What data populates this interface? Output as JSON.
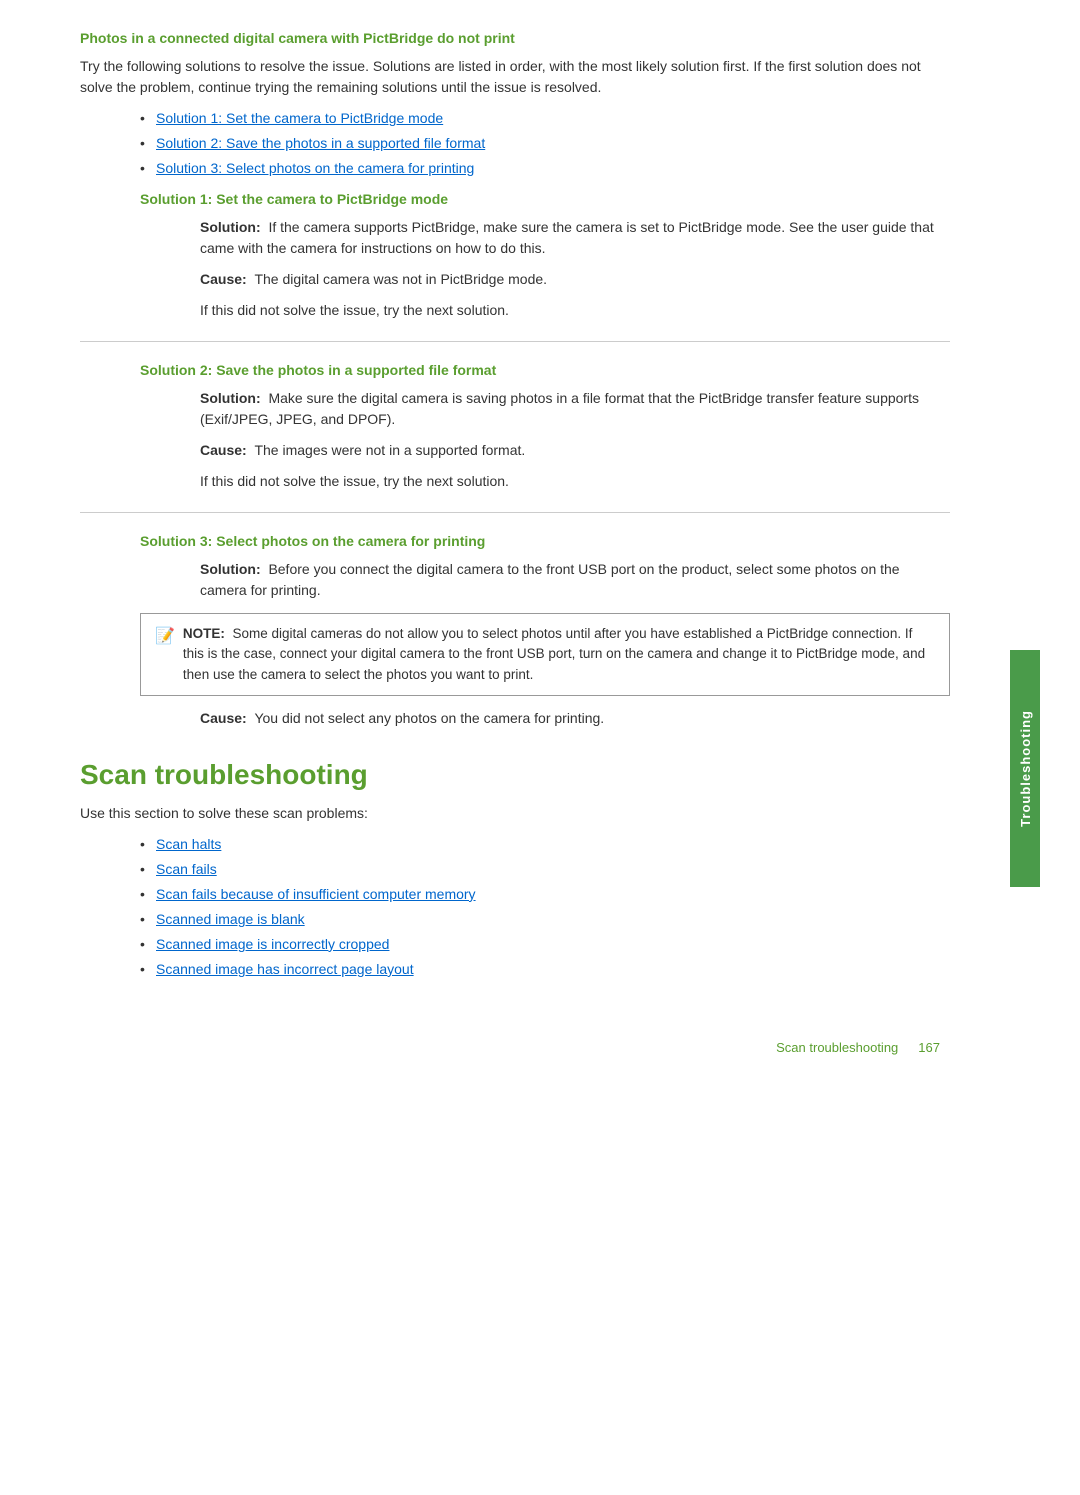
{
  "page": {
    "title": "Photos in a connected digital camera with PictBridge do not print",
    "intro": "Try the following solutions to resolve the issue. Solutions are listed in order, with the most likely solution first. If the first solution does not solve the problem, continue trying the remaining solutions until the issue is resolved.",
    "solutions_list": [
      "Solution 1: Set the camera to PictBridge mode",
      "Solution 2: Save the photos in a supported file format",
      "Solution 3: Select photos on the camera for printing"
    ],
    "solution1": {
      "heading": "Solution 1: Set the camera to PictBridge mode",
      "solution_label": "Solution:",
      "solution_text": "If the camera supports PictBridge, make sure the camera is set to PictBridge mode. See the user guide that came with the camera for instructions on how to do this.",
      "cause_label": "Cause:",
      "cause_text": "The digital camera was not in PictBridge mode.",
      "next_text": "If this did not solve the issue, try the next solution."
    },
    "solution2": {
      "heading": "Solution 2: Save the photos in a supported file format",
      "solution_label": "Solution:",
      "solution_text": "Make sure the digital camera is saving photos in a file format that the PictBridge transfer feature supports (Exif/JPEG, JPEG, and DPOF).",
      "cause_label": "Cause:",
      "cause_text": "The images were not in a supported format.",
      "next_text": "If this did not solve the issue, try the next solution."
    },
    "solution3": {
      "heading": "Solution 3: Select photos on the camera for printing",
      "solution_label": "Solution:",
      "solution_text": "Before you connect the digital camera to the front USB port on the product, select some photos on the camera for printing.",
      "note_label": "NOTE:",
      "note_text": "Some digital cameras do not allow you to select photos until after you have established a PictBridge connection. If this is the case, connect your digital camera to the front USB port, turn on the camera and change it to PictBridge mode, and then use the camera to select the photos you want to print.",
      "cause_label": "Cause:",
      "cause_text": "You did not select any photos on the camera for printing."
    },
    "scan_section": {
      "heading": "Scan troubleshooting",
      "intro": "Use this section to solve these scan problems:",
      "items": [
        "Scan halts",
        "Scan fails",
        "Scan fails because of insufficient computer memory",
        "Scanned image is blank",
        "Scanned image is incorrectly cropped",
        "Scanned image has incorrect page layout"
      ]
    },
    "sidebar": {
      "label": "Troubleshooting"
    },
    "footer": {
      "left": "Scan troubleshooting",
      "right": "167"
    }
  }
}
